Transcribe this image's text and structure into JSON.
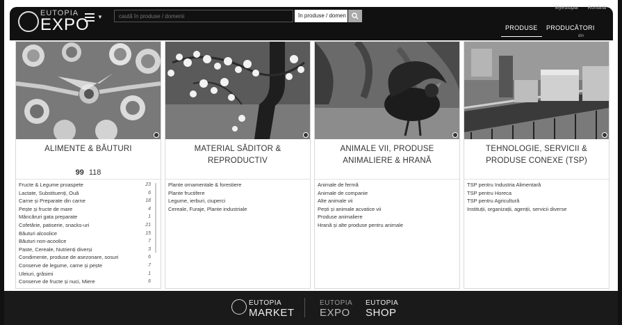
{
  "header": {
    "logo_top": "EUTOPIA",
    "logo_main": "EXPO",
    "search_placeholder": "caută în produse / domenii",
    "search_scope": "în produse / domen",
    "lang_links": [
      "MyEutopia",
      "Română"
    ],
    "nav": {
      "produse": "PRODUSE",
      "producatori": "PRODUCĂTORI",
      "din": "din"
    }
  },
  "cards": [
    {
      "title": "ALIMENTE & BĂUTURI",
      "count_primary": "99",
      "count_secondary": "118",
      "items": [
        {
          "label": "Fructe & Legume proaspete",
          "count": "23"
        },
        {
          "label": "Lactate, Substituenți, Ouă",
          "count": "6"
        },
        {
          "label": "Carne și Preparate din carne",
          "count": "18"
        },
        {
          "label": "Pește și fructe de mare",
          "count": "4"
        },
        {
          "label": "Mâncăruri gata preparate",
          "count": "1"
        },
        {
          "label": "Cofetărie, patiserie, snacks-uri",
          "count": "21"
        },
        {
          "label": "Băuturi alcoolice",
          "count": "15"
        },
        {
          "label": "Băuturi non-acoolice",
          "count": "7"
        },
        {
          "label": "Paste, Cereale, Nutrienți diverși",
          "count": "3"
        },
        {
          "label": "Condimente, produse de asezonare, sosuri",
          "count": "6"
        },
        {
          "label": "Conserve de legume, carne și pește",
          "count": "7"
        },
        {
          "label": "Uleiuri, grăsimi",
          "count": "1"
        },
        {
          "label": "Conserve de fructe și nuci, Miere",
          "count": "6"
        }
      ]
    },
    {
      "title": "MATERIAL SĂDITOR & REPRODUCTIV",
      "items": [
        {
          "label": "Plante ornamentale & forestiere"
        },
        {
          "label": "Plante fructifere"
        },
        {
          "label": "Legume, ierburi, ciuperci"
        },
        {
          "label": "Cereale, Furaje, Plante industriale"
        }
      ]
    },
    {
      "title": "ANIMALE VII, PRODUSE ANIMALIERE & HRANĂ",
      "items": [
        {
          "label": "Animale de fermă"
        },
        {
          "label": "Animale de companie"
        },
        {
          "label": "Alte animale vii"
        },
        {
          "label": "Pești și animale acvatice vii"
        },
        {
          "label": "Produse animaliere"
        },
        {
          "label": "Hrană și alte produse pentru animale"
        }
      ]
    },
    {
      "title": "TEHNOLOGIE, SERVICII & PRODUSE CONEXE (TSP)",
      "items": [
        {
          "label": "TSP pentru Industria Alimentară"
        },
        {
          "label": "TSP pentru Horeca"
        },
        {
          "label": "TSP pentru Agricultură"
        },
        {
          "label": "Instituții, organizații, agenții, servicii diverse"
        }
      ]
    }
  ],
  "footer": {
    "market": {
      "small": "EUTOPIA",
      "big": "MARKET"
    },
    "expo": {
      "small": "EUTOPIA",
      "big": "EXPO"
    },
    "shop": {
      "small": "EUTOPIA",
      "big": "SHOP"
    }
  }
}
